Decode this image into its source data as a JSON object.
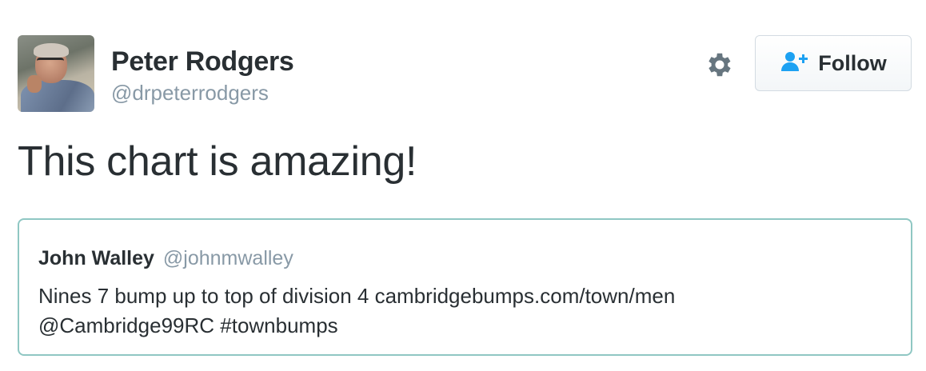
{
  "author": {
    "name": "Peter Rodgers",
    "handle": "@drpeterrodgers"
  },
  "actions": {
    "settings_icon": "gear-icon",
    "follow_icon": "follow-user-icon",
    "follow_label": "Follow"
  },
  "tweet": {
    "text": "This chart is amazing!"
  },
  "quoted_tweet": {
    "name": "John Walley",
    "handle": "@johnmwalley",
    "line1": "Nines 7 bump up to top of division 4 cambridgebumps.com/town/men",
    "line2": "@Cambridge99RC #townbumps"
  },
  "colors": {
    "accent": "#1da1f2",
    "text": "#292f33",
    "muted": "#8899a6",
    "quote_border": "#8fc7c3"
  }
}
